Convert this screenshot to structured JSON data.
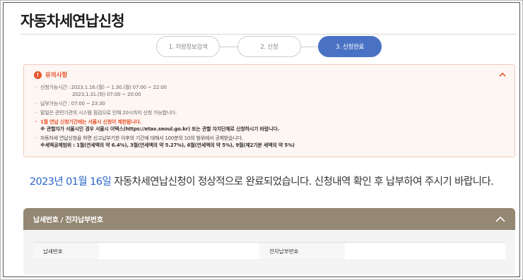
{
  "page": {
    "title": "자동차세연납신청"
  },
  "steps": [
    {
      "label": "1. 차량정보검색",
      "active": false
    },
    {
      "label": "2. 신청",
      "active": false
    },
    {
      "label": "3. 신청완료",
      "active": true
    }
  ],
  "notice": {
    "title": "유의사항",
    "icon": "warning-icon",
    "lines": {
      "period_1": "신청가능시간 : 2023.1.16.(월) ~ 1.30.(월) 07:00 ~ 22:00",
      "period_2": "2023.1.31.(화) 07:00 ~ 20:00",
      "payment": "납부가능시간 : 07:00 ~ 23:30",
      "last_day": "말일은 관련기관의 시스템 점검으로 인해 20시까지 신청 가능합니다.",
      "restriction": "1월 연납 신청기간에는 서울시 신청이 제한됩니다.",
      "restriction_note": "※ 관할자가 서울시인 경우 서울시 이택스(https://etax.seoul.go.kr) 또는 관할 자치단체로 신청하시기 바랍니다.",
      "deduction": "자동차세 연납신청을 하면 신고납부기한 이후의 기간에 대해서 100분의 10의 범위에서 공제받습니다.",
      "deduction_range": "※세액공제범위 : 1월(연세액의 약 6.4%), 3월(연세액의 약 5.27%), 6월(연세액의 약 5%), 9월(제2기분 세액의 약 5%)"
    },
    "colors": {
      "accent": "#e8522b",
      "background": "#fdf6f3"
    }
  },
  "completion": {
    "date": "2023년 01월 16일",
    "message": " 자동차세연납신청이 정상적으로 완료되었습니다. 신청내역 확인 후 납부하여 주시기 바랍니다."
  },
  "tax_panel": {
    "title": "납세번호 / 전자납부번호",
    "tax_number_label": "납세번호",
    "tax_number_value": "",
    "e_payment_label": "전자납부번호",
    "e_payment_value": "",
    "header_color": "#948873"
  },
  "colors": {
    "step_active": "#4a72c4",
    "date_highlight": "#2a64c8"
  }
}
